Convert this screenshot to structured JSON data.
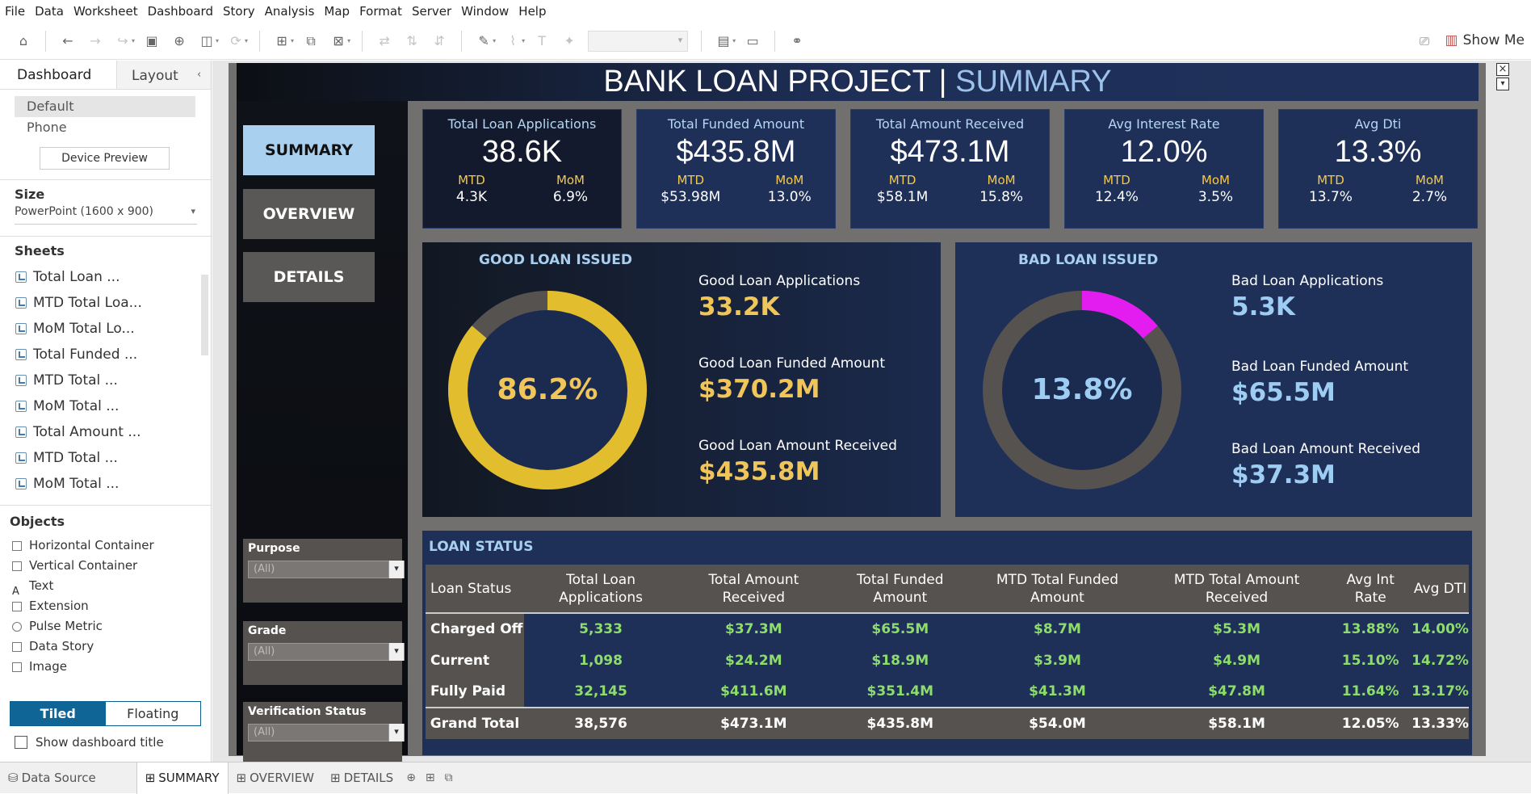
{
  "menu": [
    "File",
    "Data",
    "Worksheet",
    "Dashboard",
    "Story",
    "Analysis",
    "Map",
    "Format",
    "Server",
    "Window",
    "Help"
  ],
  "toolbar": {
    "show_me": "Show Me"
  },
  "leftpane": {
    "tab_dashboard": "Dashboard",
    "tab_layout": "Layout",
    "devices": [
      "Default",
      "Phone"
    ],
    "device_preview": "Device Preview",
    "size_heading": "Size",
    "size_value": "PowerPoint (1600 x 900)",
    "sheets_heading": "Sheets",
    "sheets": [
      "Total Loan ...",
      "MTD Total Loa...",
      "MoM Total Lo...",
      "Total Funded ...",
      "MTD Total ...",
      "MoM Total ...",
      "Total Amount ...",
      "MTD Total ...",
      "MoM Total ..."
    ],
    "objects_heading": "Objects",
    "objects": [
      "Horizontal Container",
      "Vertical Container",
      "Text",
      "Extension",
      "Pulse Metric",
      "Data Story",
      "Image"
    ],
    "tiled": "Tiled",
    "floating": "Floating",
    "show_title": "Show dashboard title"
  },
  "dashboard": {
    "title_main": "BANK LOAN PROJECT | ",
    "title_accent": "SUMMARY",
    "nav": [
      "SUMMARY",
      "OVERVIEW",
      "DETAILS"
    ],
    "filters": [
      {
        "label": "Purpose",
        "value": "(All)"
      },
      {
        "label": "Grade",
        "value": "(All)"
      },
      {
        "label": "Verification Status",
        "value": "(All)"
      }
    ],
    "kpis": [
      {
        "title": "Total Loan Applications",
        "value": "38.6K",
        "mtd_label": "MTD",
        "mtd": "4.3K",
        "mom_label": "MoM",
        "mom": "6.9%"
      },
      {
        "title": "Total Funded Amount",
        "value": "$435.8M",
        "mtd_label": "MTD",
        "mtd": "$53.98M",
        "mom_label": "MoM",
        "mom": "13.0%"
      },
      {
        "title": "Total Amount Received",
        "value": "$473.1M",
        "mtd_label": "MTD",
        "mtd": "$58.1M",
        "mom_label": "MoM",
        "mom": "15.8%"
      },
      {
        "title": "Avg Interest Rate",
        "value": "12.0%",
        "mtd_label": "MTD",
        "mtd": "12.4%",
        "mom_label": "MoM",
        "mom": "3.5%"
      },
      {
        "title": "Avg Dti",
        "value": "13.3%",
        "mtd_label": "MTD",
        "mtd": "13.7%",
        "mom_label": "MoM",
        "mom": "2.7%"
      }
    ],
    "good": {
      "heading": "GOOD LOAN ISSUED",
      "pct": "86.2%",
      "pct_value": 0.862,
      "apps_label": "Good Loan Applications",
      "apps": "33.2K",
      "funded_label": "Good Loan Funded Amount",
      "funded": "$370.2M",
      "received_label": "Good Loan Amount Received",
      "received": "$435.8M",
      "color": "#e2bd2e"
    },
    "bad": {
      "heading": "BAD LOAN ISSUED",
      "pct": "13.8%",
      "pct_value": 0.138,
      "apps_label": "Bad Loan Applications",
      "apps": "5.3K",
      "funded_label": "Bad Loan Funded Amount",
      "funded": "$65.5M",
      "received_label": "Bad Loan Amount Received",
      "received": "$37.3M",
      "color": "#e31cf0"
    },
    "loan_status": {
      "heading": "LOAN STATUS",
      "columns": [
        "Loan Status",
        "Total Loan Applications",
        "Total Amount Received",
        "Total Funded Amount",
        "MTD Total Funded Amount",
        "MTD Total Amount Received",
        "Avg Int Rate",
        "Avg DTI"
      ],
      "rows": [
        [
          "Charged Off",
          "5,333",
          "$37.3M",
          "$65.5M",
          "$8.7M",
          "$5.3M",
          "13.88%",
          "14.00%"
        ],
        [
          "Current",
          "1,098",
          "$24.2M",
          "$18.9M",
          "$3.9M",
          "$4.9M",
          "15.10%",
          "14.72%"
        ],
        [
          "Fully Paid",
          "32,145",
          "$411.6M",
          "$351.4M",
          "$41.3M",
          "$47.8M",
          "11.64%",
          "13.17%"
        ]
      ],
      "total": [
        "Grand Total",
        "38,576",
        "$473.1M",
        "$435.8M",
        "$54.0M",
        "$58.1M",
        "12.05%",
        "13.33%"
      ]
    }
  },
  "bottom_tabs": {
    "data_source": "Data Source",
    "sheets": [
      "SUMMARY",
      "OVERVIEW",
      "DETAILS"
    ]
  }
}
